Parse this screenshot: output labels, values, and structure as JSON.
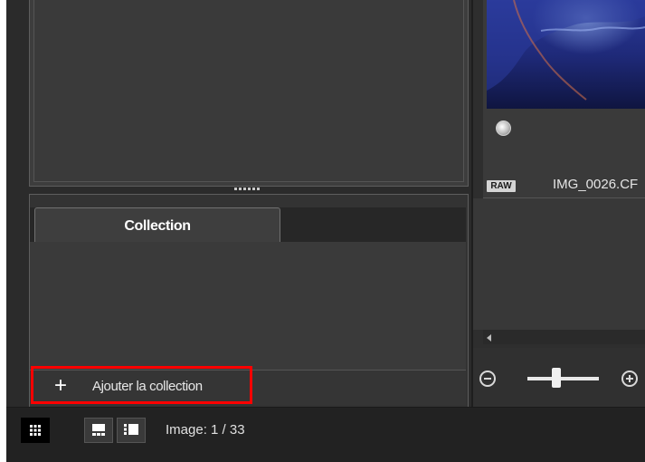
{
  "collection_panel": {
    "tab_label": "Collection",
    "add_button_label": "Ajouter la collection",
    "add_icon": "plus-icon"
  },
  "thumbnail": {
    "raw_badge": "RAW",
    "filename": "IMG_0026.CF",
    "status_icon": "rating-circle-icon"
  },
  "zoom": {
    "minus_icon": "zoom-out-icon",
    "plus_icon": "zoom-in-icon",
    "level": 0.35
  },
  "statusbar": {
    "view_modes": [
      "grid-view-icon",
      "filmstrip-view-icon",
      "compare-view-icon"
    ],
    "image_count": "Image: 1 / 33"
  },
  "colors": {
    "highlight_border": "#ff0000"
  }
}
